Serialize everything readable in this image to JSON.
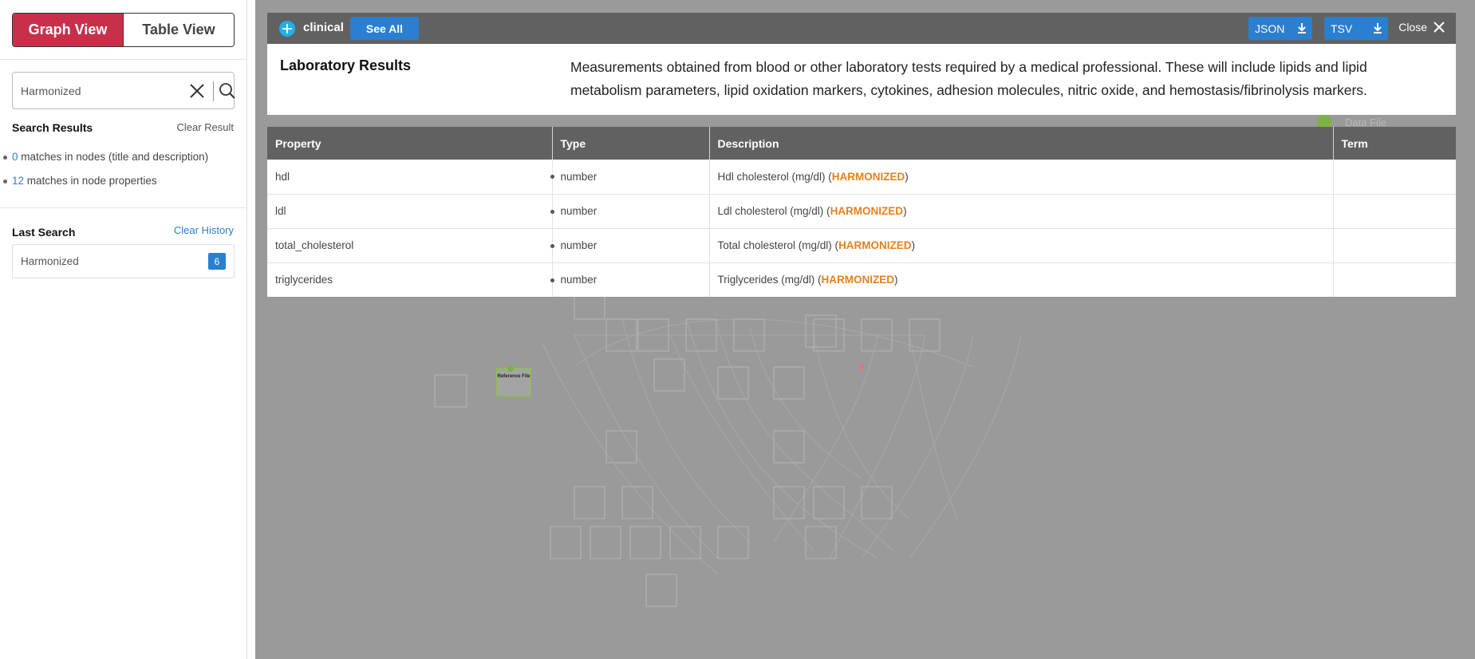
{
  "sidebar": {
    "graph_view_label": "Graph View",
    "table_view_label": "Table View",
    "search_value": "Harmonized",
    "search_results_title": "Search Results",
    "clear_result_label": "Clear Result",
    "matches": [
      {
        "count": "0",
        "text": " matches in nodes (title and description)"
      },
      {
        "count": "12",
        "text": " matches in node properties"
      }
    ],
    "last_search_title": "Last Search",
    "clear_history_label": "Clear History",
    "history": [
      {
        "label": "Harmonized",
        "count": "6"
      }
    ]
  },
  "modal": {
    "node_name": "clinical",
    "see_all_label": "See All",
    "json_label": "JSON",
    "tsv_label": "TSV",
    "close_label": "Close",
    "title": "Laboratory Results",
    "description": "Measurements obtained from blood or other laboratory tests required by a medical professional. These will include lipids and lipid metabolism parameters, lipid oxidation markers, cytokines, adhesion molecules, nitric oxide, and hemostasis/fibrinolysis markers."
  },
  "table": {
    "headers": [
      "Property",
      "Type",
      "Description",
      "Term"
    ],
    "rows": [
      {
        "property": "hdl",
        "type": "number",
        "desc_pre": "Hdl cholesterol (mg/dl) (",
        "desc_hl": "HARMONIZED",
        "desc_post": ")",
        "term": ""
      },
      {
        "property": "ldl",
        "type": "number",
        "desc_pre": "Ldl cholesterol (mg/dl) (",
        "desc_hl": "HARMONIZED",
        "desc_post": ")",
        "term": ""
      },
      {
        "property": "total_cholesterol",
        "type": "number",
        "desc_pre": "Total cholesterol (mg/dl) (",
        "desc_hl": "HARMONIZED",
        "desc_post": ")",
        "term": ""
      },
      {
        "property": "triglycerides",
        "type": "number",
        "desc_pre": "Triglycerides (mg/dl) (",
        "desc_hl": "HARMONIZED",
        "desc_post": ")",
        "term": ""
      }
    ]
  },
  "background": {
    "data_file_label": "Data File",
    "reference_file_label": "Reference File"
  },
  "colors": {
    "primary": "#2a7fd0",
    "active_tab": "#c8304a",
    "highlight": "#e6801c",
    "header_bg": "#616161"
  }
}
